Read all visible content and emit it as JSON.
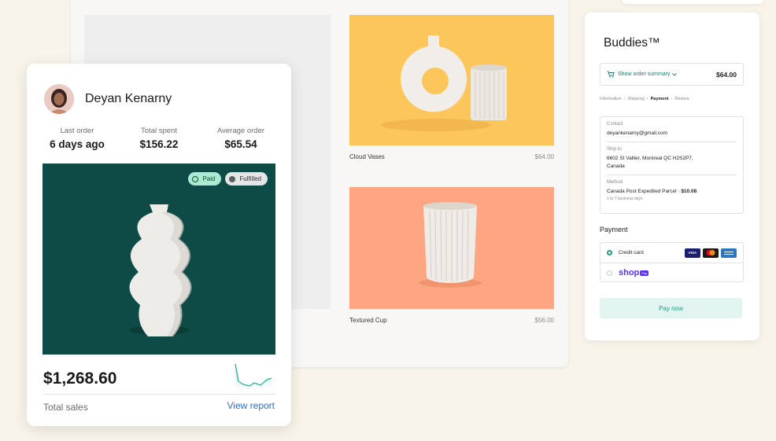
{
  "storefront": {
    "products": [
      {
        "name": "Cloud Vases",
        "price": "$64.00"
      },
      {
        "name": "Textured Cup",
        "price": "$56.00"
      }
    ],
    "colors": {
      "product1_bg": "#fdc65b",
      "product2_bg": "#fea681"
    }
  },
  "customer": {
    "name": "Deyan Kenarny",
    "stats": [
      {
        "label": "Last order",
        "value": "6 days ago"
      },
      {
        "label": "Total spent",
        "value": "$156.22"
      },
      {
        "label": "Average order",
        "value": "$65.54"
      }
    ],
    "badges": {
      "paid": "Paid",
      "fulfilled": "Fulfilled"
    },
    "total_sales": "$1,268.60",
    "total_sales_label": "Total sales",
    "view_report": "View report",
    "hero_bg": "#0e4b46"
  },
  "checkout": {
    "brand": "Buddies™",
    "summary_link": "Show order summary",
    "summary_total": "$64.00",
    "breadcrumbs": [
      "Information",
      "Shipping",
      "Payment",
      "Review"
    ],
    "current_step": "Payment",
    "contact_label": "Contact",
    "contact_value": "deyankenarny@gmail.com",
    "ship_label": "Ship to",
    "ship_line1": "6602 St Vallier, Montreal QC  H2S2P7,",
    "ship_line2": "Canada",
    "method_label": "Method",
    "method_value": "Canada Post Expedited Parcel · ",
    "method_price": "$10.08",
    "method_sub": "1 to 7 business days",
    "payment_heading": "Payment",
    "credit_card_label": "Credit card",
    "card_brands": [
      "VISA",
      "MC",
      "AMEX"
    ],
    "shop_label": "shop",
    "shop_pay_tag": "Pay",
    "pay_button": "Pay now",
    "accent": "#1f9a83"
  }
}
